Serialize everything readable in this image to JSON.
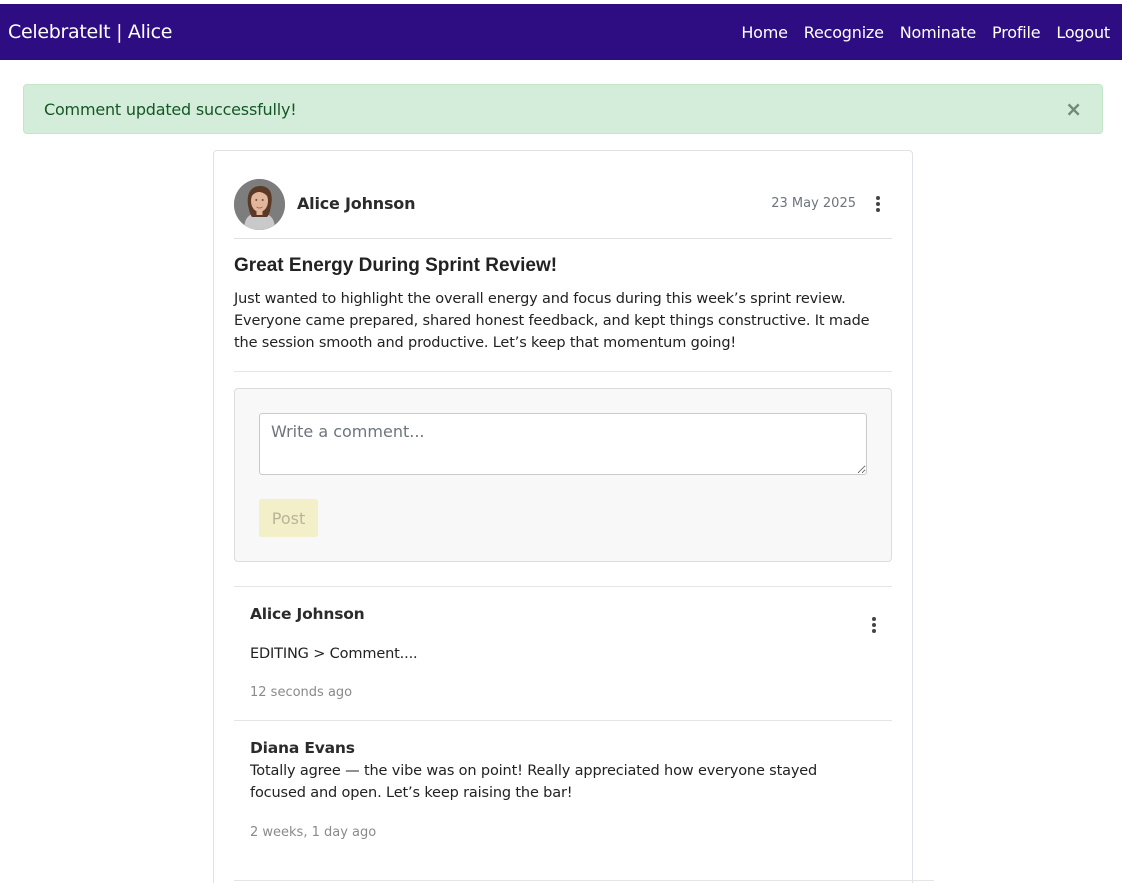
{
  "navbar": {
    "brand": "CelebrateIt | Alice",
    "links": [
      "Home",
      "Recognize",
      "Nominate",
      "Profile",
      "Logout"
    ]
  },
  "alert": {
    "message": "Comment updated successfully!",
    "close_symbol": "×"
  },
  "post": {
    "author": "Alice Johnson",
    "date": "23 May 2025",
    "title": "Great Energy During Sprint Review!",
    "body": "Just wanted to highlight the overall energy and focus during this week’s sprint review. Everyone came prepared, shared honest feedback, and kept things constructive. It made the session smooth and productive. Let’s keep that momentum going!"
  },
  "comment_form": {
    "placeholder": "Write a comment...",
    "value": "",
    "post_label": "Post"
  },
  "comments": [
    {
      "author": "Alice Johnson",
      "text": "EDITING > Comment....",
      "time": "12 seconds ago"
    },
    {
      "author": "Diana Evans",
      "text": "Totally agree — the vibe was on point! Really appreciated how everyone stayed focused and open. Let’s keep raising the bar!",
      "time": "2 weeks, 1 day ago"
    }
  ],
  "colors": {
    "navbar": "#2e0d82",
    "alert_bg": "#d4edda",
    "alert_text": "#155724",
    "post_button_bg": "#f3efc9"
  },
  "icons": {
    "post_menu": "kebab-vertical-icon",
    "comment_menu": "kebab-vertical-icon",
    "alert_close": "close-icon"
  }
}
